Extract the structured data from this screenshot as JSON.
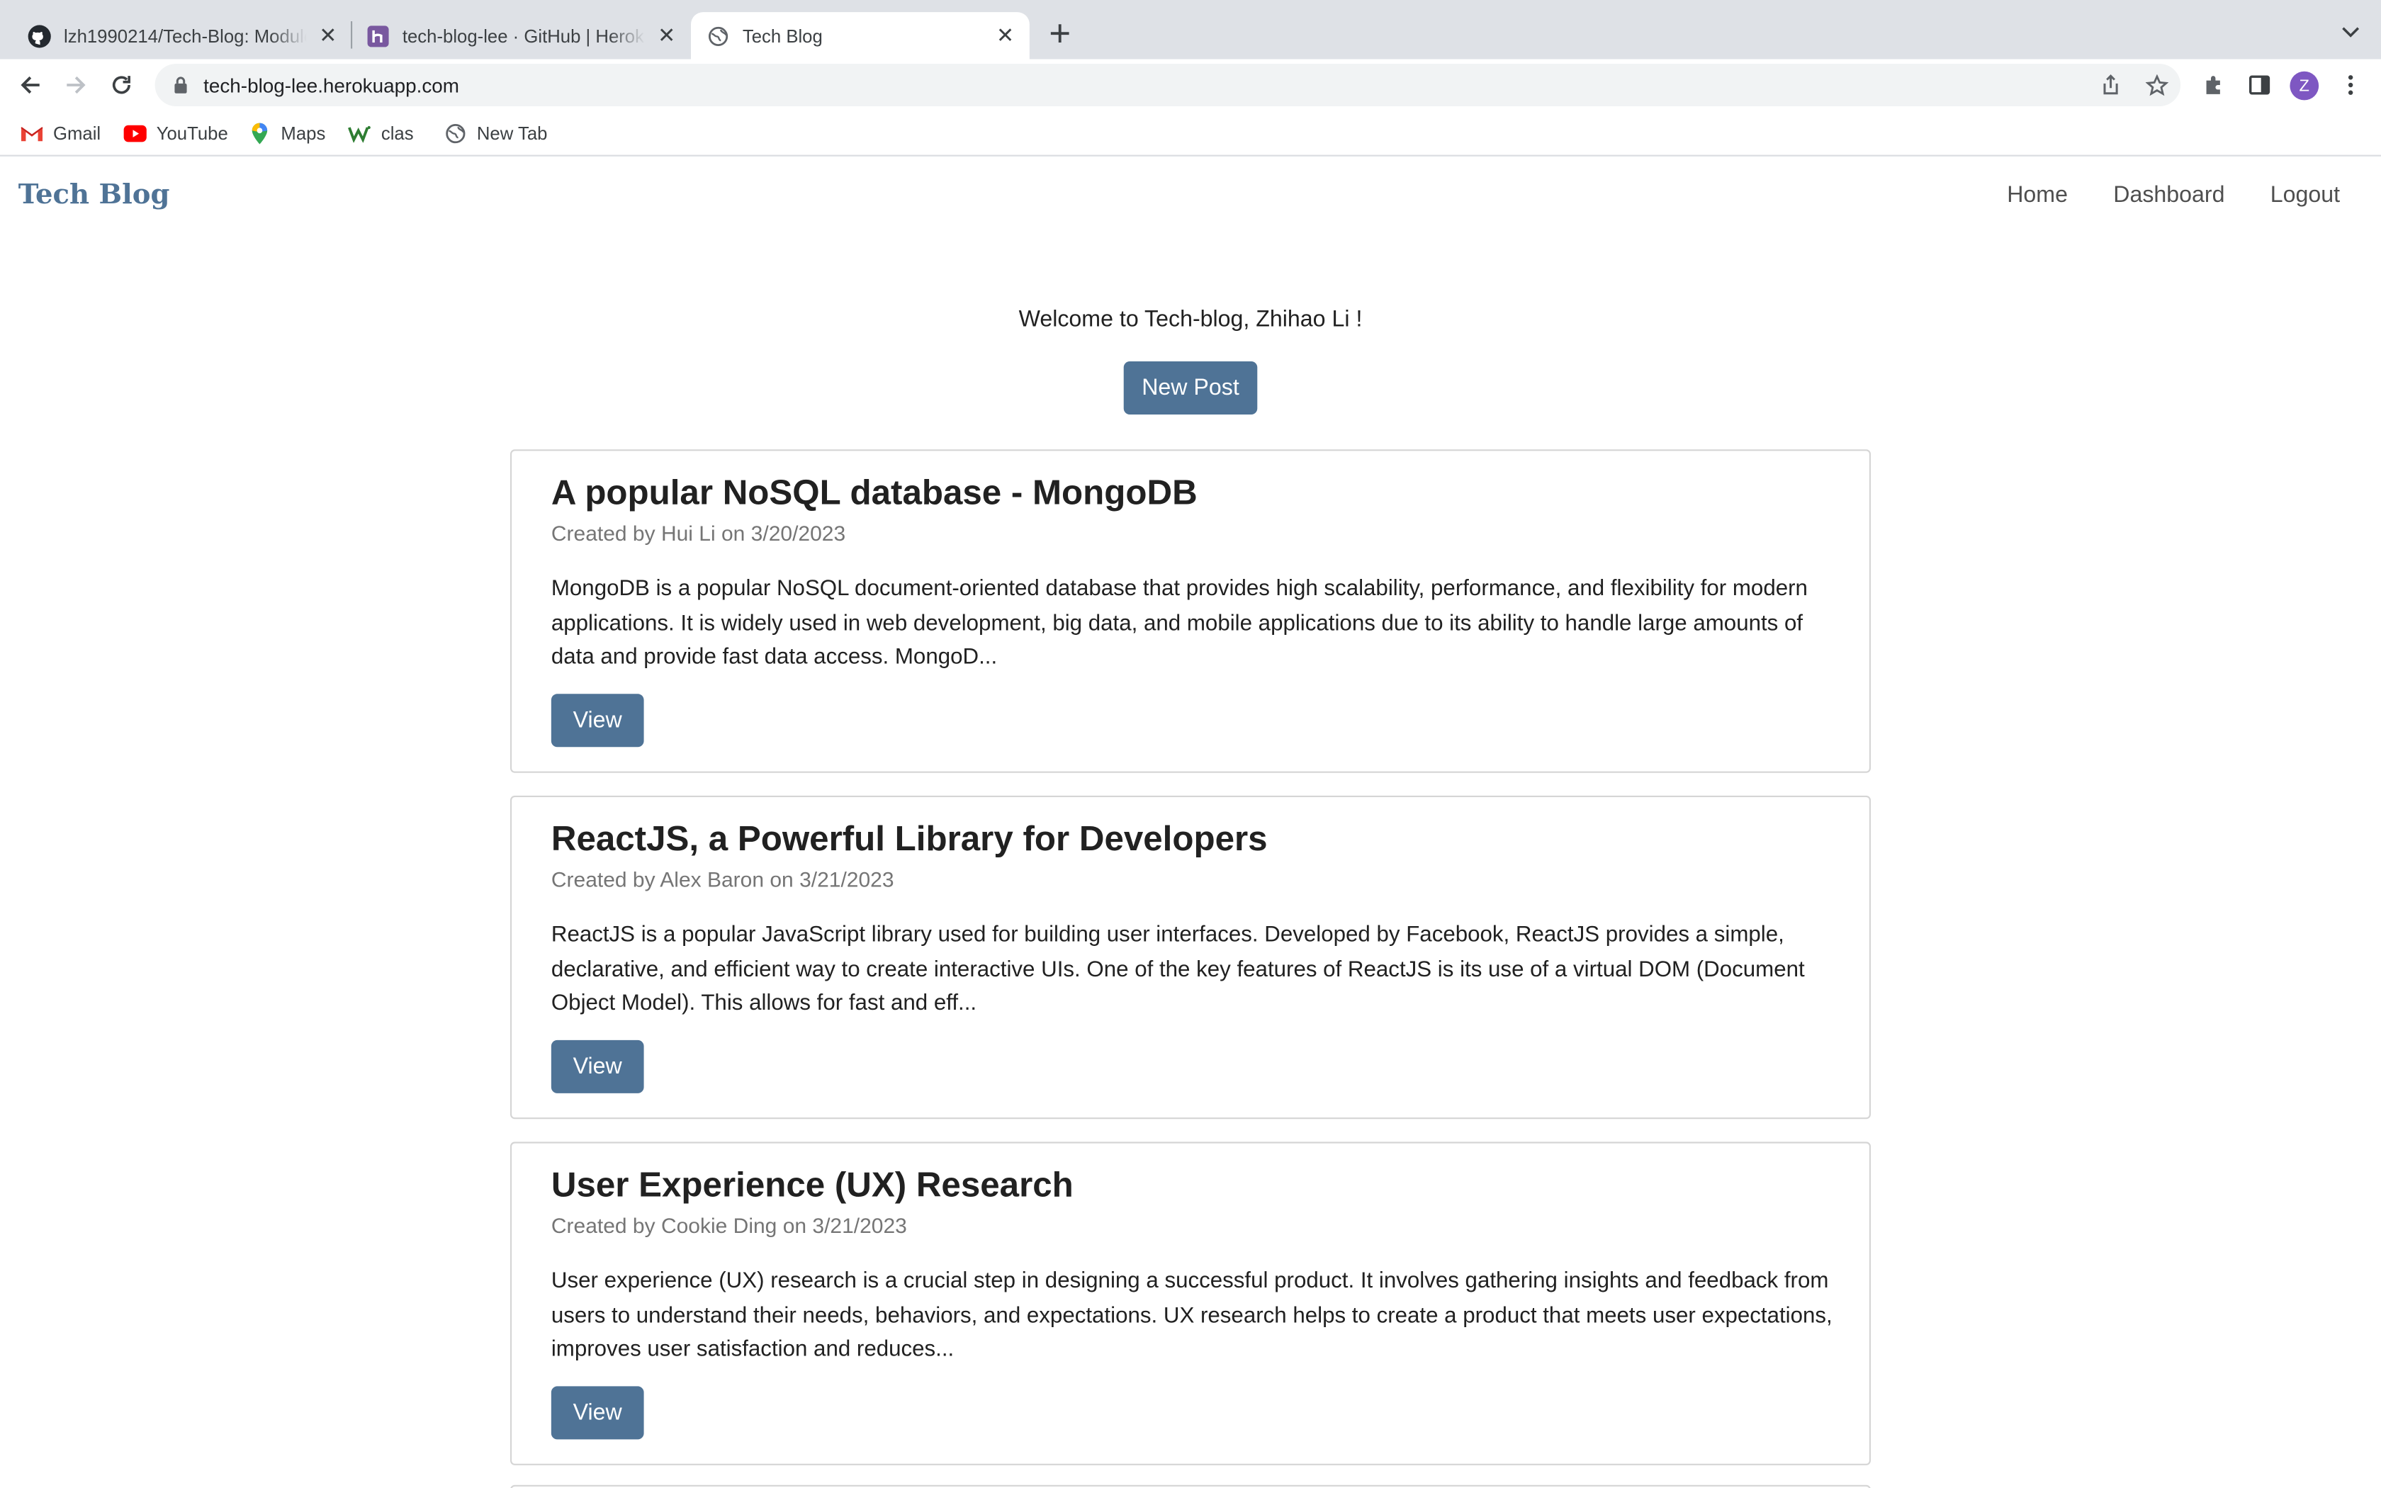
{
  "browser": {
    "tabs": [
      {
        "title": "lzh1990214/Tech-Blog: Module",
        "icon": "github-icon"
      },
      {
        "title": "tech-blog-lee · GitHub | Heroku",
        "icon": "heroku-icon"
      },
      {
        "title": "Tech Blog",
        "icon": "globe-icon",
        "active": true
      }
    ],
    "url": "tech-blog-lee.herokuapp.com",
    "profile_initial": "Z",
    "bookmarks": [
      {
        "label": "Gmail",
        "icon": "gmail-icon"
      },
      {
        "label": "YouTube",
        "icon": "youtube-icon"
      },
      {
        "label": "Maps",
        "icon": "maps-icon"
      },
      {
        "label": "clas",
        "icon": "w-icon"
      },
      {
        "label": "New Tab",
        "icon": "globe-icon"
      }
    ]
  },
  "site": {
    "logo": "Tech Blog",
    "nav": {
      "home": "Home",
      "dashboard": "Dashboard",
      "logout": "Logout"
    },
    "welcome": "Welcome to Tech-blog, Zhihao Li !",
    "new_post": "New Post",
    "accent": "#4f7396"
  },
  "posts": [
    {
      "title": "A popular NoSQL database - MongoDB",
      "meta": "Created by Hui Li on 3/20/2023",
      "body": "MongoDB is a popular NoSQL document-oriented database that provides high scalability, performance, and flexibility for modern applications. It is widely used in web development, big data, and mobile applications due to its ability to handle large amounts of data and provide fast data access. MongoD...",
      "view": "View"
    },
    {
      "title": "ReactJS, a Powerful Library for Developers",
      "meta": "Created by Alex Baron on 3/21/2023",
      "body": "ReactJS is a popular JavaScript library used for building user interfaces. Developed by Facebook, ReactJS provides a simple, declarative, and efficient way to create interactive UIs. One of the key features of ReactJS is its use of a virtual DOM (Document Object Model). This allows for fast and eff...",
      "view": "View"
    },
    {
      "title": "User Experience (UX) Research",
      "meta": "Created by Cookie Ding on 3/21/2023",
      "body": "User experience (UX) research is a crucial step in designing a successful product. It involves gathering insights and feedback from users to understand their needs, behaviors, and expectations. UX research helps to create a product that meets user expectations, improves user satisfaction and reduces...",
      "view": "View"
    }
  ]
}
